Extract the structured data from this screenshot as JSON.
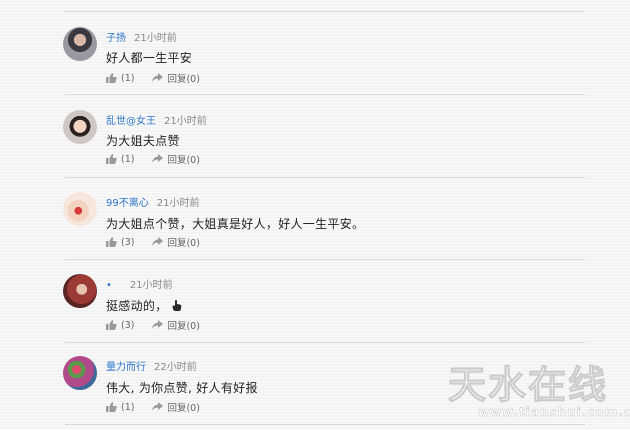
{
  "comments": [
    {
      "user": "子扬",
      "time": "21小时前",
      "text": "好人都一生平安",
      "likes": "(1)",
      "reply": "回复(0)",
      "avatar_color": "#6d6a73",
      "user_color": "#2e77c9"
    },
    {
      "user": "乱世@女王",
      "time": "21小时前",
      "text": "为大姐夫点赞",
      "likes": "(1)",
      "reply": "回复(0)",
      "avatar_color": "#c9a99b",
      "user_color": "#2e77c9"
    },
    {
      "user": "99不离心",
      "time": "21小时前",
      "text": "为大姐点个赞，大姐真是好人，好人一生平安。",
      "likes": "(3)",
      "reply": "回复(0)",
      "avatar_color": "#e3b9a4",
      "user_color": "#2e77c9"
    },
    {
      "user": "•",
      "time": "21小时前",
      "text": "挺感动的，",
      "likes": "(3)",
      "reply": "回复(0)",
      "avatar_color": "#8a3e3a",
      "user_color": "#2e77c9"
    },
    {
      "user": "量力而行",
      "time": "22小时前",
      "text": "伟大, 为你点赞, 好人有好报",
      "likes": "(1)",
      "reply": "回复(0)",
      "avatar_color": "#8f5a7a",
      "user_color": "#2e77c9"
    }
  ],
  "watermark": {
    "title": "天水在线",
    "url": "www.tianshui.com.cn"
  },
  "icons": {
    "like": "thumbs-up-icon",
    "reply": "reply-arrow-icon",
    "emoji": "pointing-hand-emoji-icon"
  }
}
